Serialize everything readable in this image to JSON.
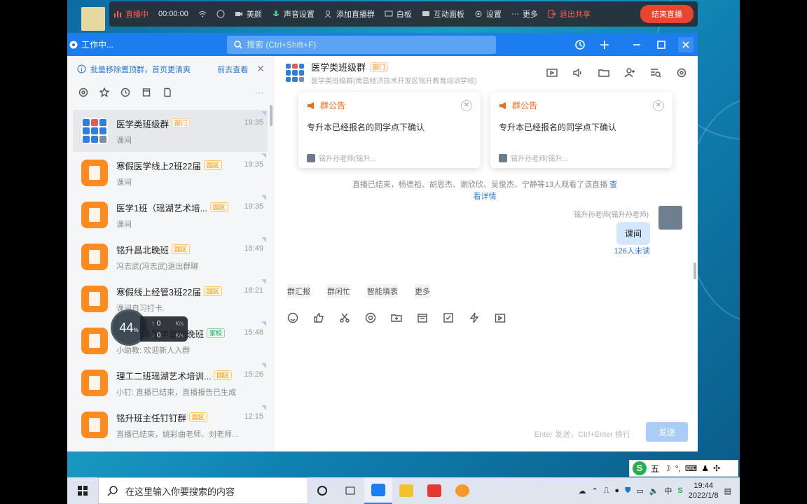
{
  "live": {
    "status": "直播中",
    "timer": "00:00:00",
    "beauty": "美颜",
    "sound": "声音设置",
    "add_group": "添加直播群",
    "whiteboard": "白板",
    "interactive": "互动面板",
    "settings": "设置",
    "more": "更多",
    "exit_share": "退出共享",
    "end": "结束直播"
  },
  "titlebar": {
    "status": "工作中...",
    "search_placeholder": "搜索 (Ctrl+Shift+F)"
  },
  "left": {
    "notice": "批量移除置顶群，首页更清爽",
    "notice_link": "前去查看",
    "conversations": [
      {
        "name": "医学类班级群",
        "tag": "部门",
        "tag_type": "dept",
        "sub": "课间",
        "time": "19:35",
        "avatar": "grid"
      },
      {
        "name": "寒假医学线上2班22届",
        "tag": "园区",
        "tag_type": "edu",
        "sub": "课间",
        "time": "19:35",
        "avatar": "orange"
      },
      {
        "name": "医学1班（瑶湖艺术培...",
        "tag": "园区",
        "tag_type": "edu",
        "sub": "课间",
        "time": "19:35",
        "avatar": "orange"
      },
      {
        "name": "铭升昌北晚班",
        "tag": "园区",
        "tag_type": "edu",
        "sub": "冯志武(冯志武)退出群聊",
        "time": "18:49",
        "avatar": "orange"
      },
      {
        "name": "寒假线上经管3班22届",
        "tag": "园区",
        "tag_type": "edu",
        "sub": "课间自习打卡.",
        "time": "18:21",
        "avatar": "orange"
      },
      {
        "name": "铭升秋季医学基础晚班",
        "tag": "家校",
        "tag_type": "home",
        "sub": "小助教: 欢迎新人入群",
        "time": "15:48",
        "avatar": "orange"
      },
      {
        "name": "理工二班瑶湖艺术培训...",
        "tag": "园区",
        "tag_type": "edu",
        "sub": "小钉: 直播已结束，直播报告已生成",
        "time": "15:26",
        "avatar": "orange"
      },
      {
        "name": "铭升班主任钉钉群",
        "tag": "园区",
        "tag_type": "edu",
        "sub": "直播已结束，姚彩曲老师、刘老师...",
        "time": "12:15",
        "avatar": "orange"
      }
    ]
  },
  "speed": {
    "percent": "44",
    "percent_unit": "%",
    "up": "0",
    "down": "0",
    "unit": "K/s"
  },
  "chat": {
    "title": "医学类班级群",
    "title_tag": "部门",
    "subtitle": "医学类班级群(南昌经济技术开发区铭升教育培训学校)",
    "announcements": [
      {
        "label": "群公告",
        "text": "专升本已经报名的同学点下确认",
        "from": "铭升孙老师(铭升..."
      },
      {
        "label": "群公告",
        "text": "专升本已经报名的同学点下确认",
        "from": "铭升孙老师(铭升..."
      }
    ],
    "system_message": "直播已结束，杨德祖、胡思杰、谢欣欣、吴俊杰、宁静等13人观看了该直播",
    "system_link": "查看详情",
    "sender": "铭升孙老师(铭升孙老师)",
    "message": "课间",
    "unread": "126人未读",
    "quick_tabs": [
      "群汇报",
      "群闲忙",
      "智能填表",
      "更多"
    ],
    "send_hint": "Enter 发送，Ctrl+Enter 换行",
    "send_label": "发送"
  },
  "ime": {
    "mode": "五"
  },
  "taskbar": {
    "search_placeholder": "在这里输入你要搜索的内容",
    "ime_lang": "中",
    "time": "19:44",
    "date": "2022/1/8"
  }
}
